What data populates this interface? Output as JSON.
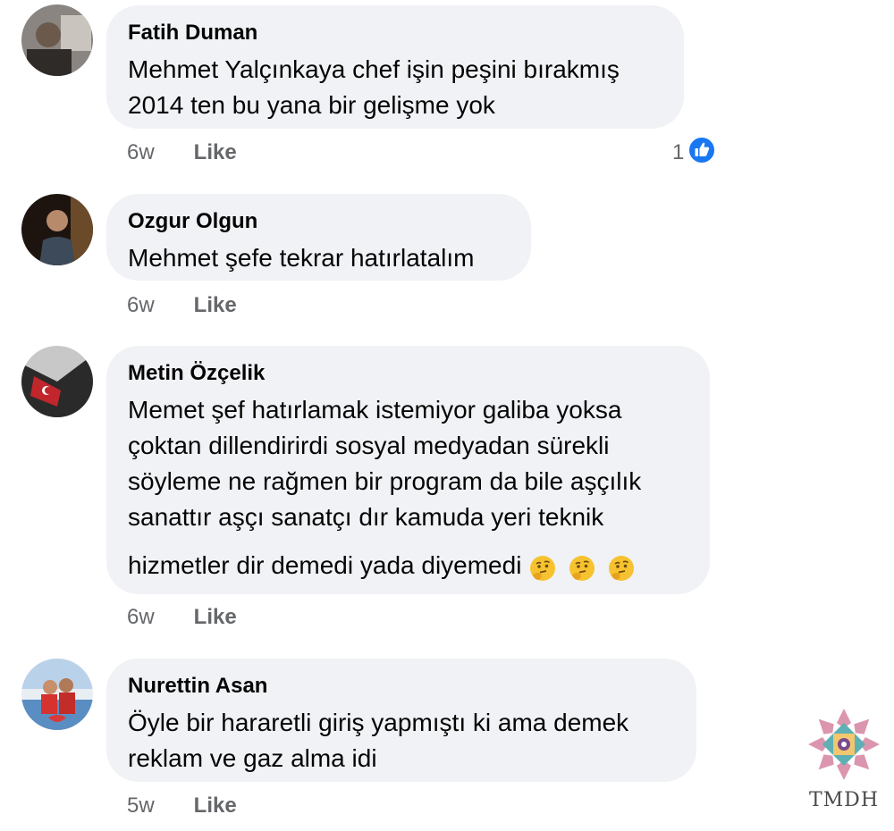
{
  "comments": [
    {
      "author": "Fatih Duman",
      "text": "Mehmet Yalçınkaya chef işin peşini bırakmış\n2014 ten bu yana bir gelişme yok",
      "time": "6w",
      "like_label": "Like",
      "reaction_count": "1"
    },
    {
      "author": "Ozgur Olgun",
      "text": "Mehmet şefe tekrar hatırlatalım",
      "time": "6w",
      "like_label": "Like"
    },
    {
      "author": "Metin Özçelik",
      "text": "Memet şef hatırlamak istemiyor galiba yoksa\nçoktan dillendirirdi sosyal medyadan sürekli\nsöyleme ne rağmen bir program da bile aşçılık\nsanattır aşçı sanatçı dır kamuda yeri teknik",
      "text_last": "hizmetler dir demedi yada diyemedi",
      "emojis": [
        "thinking-face-emoji",
        "thinking-face-emoji",
        "thinking-face-emoji"
      ],
      "time": "6w",
      "like_label": "Like"
    },
    {
      "author": "Nurettin Asan",
      "text": "Öyle bir hararetli giriş yapmıştı ki ama demek\nreklam ve gaz alma idi",
      "time": "5w",
      "like_label": "Like"
    }
  ],
  "reaction_icon": "like-reaction-icon",
  "colors": {
    "bubble": "#f0f2f5",
    "meta_text": "#65676b",
    "like_blue": "#1877f2"
  },
  "watermark": {
    "text": "TMDH"
  }
}
